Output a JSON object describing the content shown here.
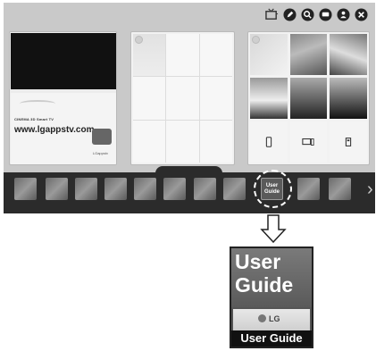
{
  "top_icons": [
    "tv-input-icon",
    "edit-icon",
    "search-icon",
    "chat-icon",
    "user-icon",
    "close-icon"
  ],
  "promo": {
    "brand": "CINEMA 3D Smart TV",
    "url": "www.lgappstv.com",
    "lgapps": "LGappstv"
  },
  "launcher": {
    "selected_app_label": "User Guide",
    "selected_app_mini_line1": "User",
    "selected_app_mini_line2": "Guide"
  },
  "enlarged_icon": {
    "word1": "User",
    "word2": "Guide",
    "brand": "LG",
    "caption": "User Guide"
  },
  "colors": {
    "tv_background": "#c9c9c9",
    "launcher_bar": "#2b2b2b",
    "icon_caption_bg": "#111111"
  }
}
